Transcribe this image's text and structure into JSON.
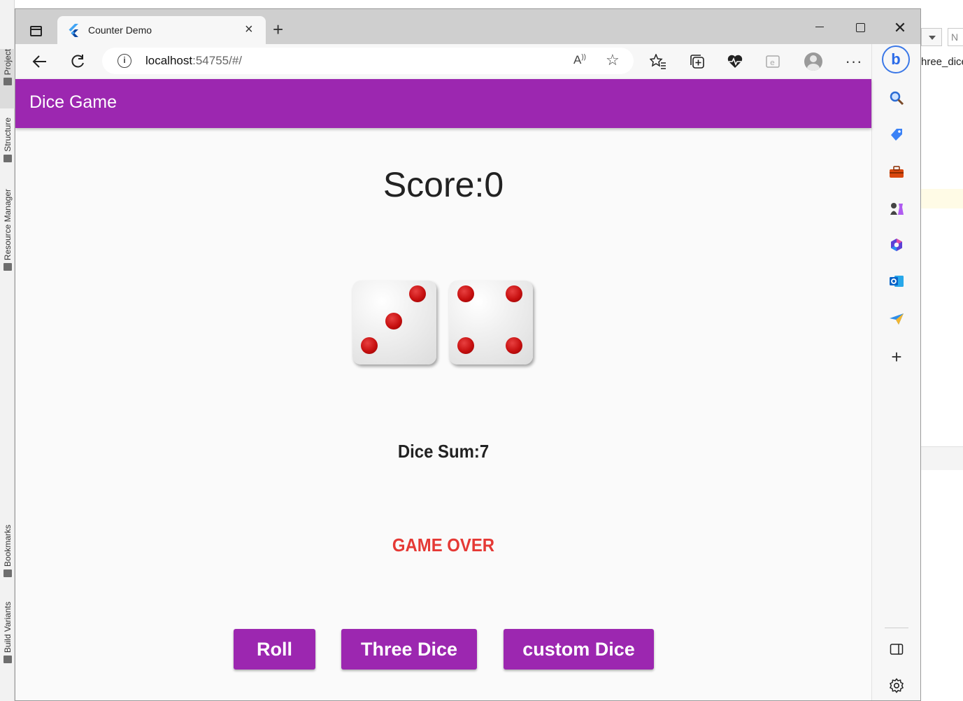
{
  "ide": {
    "left_tabs": [
      "Project",
      "Structure",
      "Resource Manager",
      "Bookmarks",
      "Build Variants"
    ],
    "right_partial_filename": "hree_dice",
    "right_partial_box": "N"
  },
  "browser": {
    "tab": {
      "title": "Counter Demo",
      "close": "×"
    },
    "new_tab": "+",
    "window": {
      "close": "✕"
    },
    "url": {
      "host": "localhost",
      "path": ":54755/#/"
    },
    "toolbar_icons": [
      "back-icon",
      "reload-icon",
      "info-icon",
      "read-aloud-icon",
      "add-favorite-icon",
      "favorites-icon",
      "collections-icon",
      "browser-essentials-icon",
      "ie-mode-icon",
      "profile-icon",
      "more-icon"
    ],
    "sidebar_icons": [
      "bing-icon",
      "search-icon",
      "shopping-icon",
      "tools-icon",
      "games-icon",
      "microsoft365-icon",
      "outlook-icon",
      "drop-icon",
      "add-icon",
      "split-panel-icon",
      "settings-icon"
    ]
  },
  "app": {
    "title": "Dice Game",
    "score_label": "Score:0",
    "dice_values": [
      3,
      4
    ],
    "dice_sum_label": "Dice Sum:7",
    "status": "GAME OVER",
    "buttons": {
      "roll": "Roll",
      "three_dice": "Three Dice",
      "custom_dice": "custom Dice"
    },
    "colors": {
      "primary": "#9c27b0",
      "status": "#e53935",
      "pip": "#c71010"
    }
  }
}
